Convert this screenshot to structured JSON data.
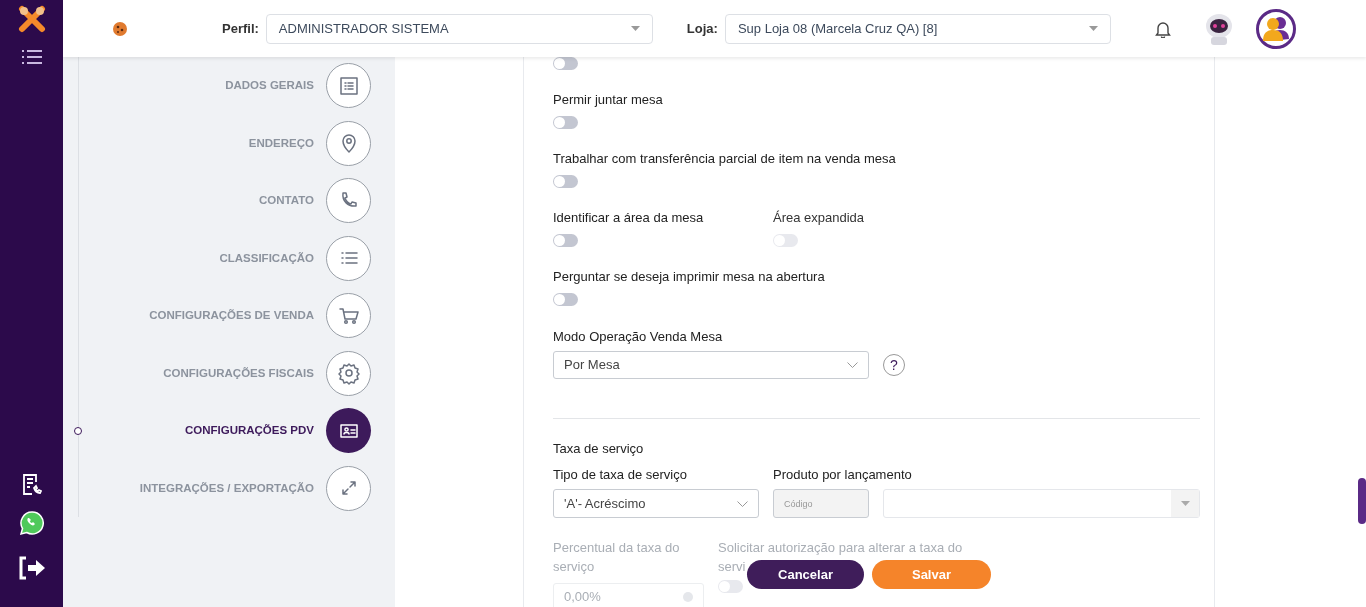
{
  "header": {
    "profile_label": "Perfil:",
    "profile_value": "ADMINISTRADOR SISTEMA",
    "store_label": "Loja:",
    "store_value": "Sup Loja 08 (Marcela Cruz QA) [8]"
  },
  "steps": [
    {
      "label": "DADOS GERAIS",
      "selected": false
    },
    {
      "label": "ENDEREÇO",
      "selected": false
    },
    {
      "label": "CONTATO",
      "selected": false
    },
    {
      "label": "CLASSIFICAÇÃO",
      "selected": false
    },
    {
      "label": "CONFIGURAÇÕES DE VENDA",
      "selected": false
    },
    {
      "label": "CONFIGURAÇÕES FISCAIS",
      "selected": false
    },
    {
      "label": "CONFIGURAÇÕES PDV",
      "selected": true
    },
    {
      "label": "INTEGRAÇÕES / EXPORTAÇÃO",
      "selected": false
    }
  ],
  "rows": [
    {
      "fields": [
        {
          "kind": "toggle",
          "on": false,
          "disabled": false
        }
      ]
    },
    {
      "fields": [
        {
          "kind": "toggle",
          "label": "Permir juntar mesa",
          "on": false,
          "disabled": false
        }
      ]
    },
    {
      "fields": [
        {
          "kind": "toggle",
          "label": "Trabalhar com transferência parcial de item na venda mesa",
          "on": false,
          "disabled": false
        }
      ]
    },
    {
      "fields": [
        {
          "kind": "toggle",
          "label": "Identificar a área da mesa",
          "on": false,
          "disabled": false
        },
        {
          "kind": "toggle",
          "label": "Área expandida",
          "on": false,
          "disabled": true
        }
      ]
    },
    {
      "fields": [
        {
          "kind": "toggle",
          "label": "Perguntar se deseja imprimir mesa na abertura",
          "on": false,
          "disabled": false
        }
      ]
    },
    {
      "fields": [
        {
          "kind": "select",
          "label": "Modo Operação Venda Mesa",
          "value": "Por Mesa",
          "help": "?"
        }
      ]
    }
  ],
  "service": {
    "title": "Taxa de serviço",
    "type_label": "Tipo de taxa de serviço",
    "type_value": "'A'- Acréscimo",
    "product_label": "Produto por lançamento",
    "code_placeholder": "Código",
    "percent_label": "Percentual da taxa do serviço",
    "percent_value": "0,00%",
    "auth_label_lines": [
      "Solicitar autorização para alterar a taxa do",
      "servi"
    ],
    "auth_on": false
  },
  "footer": {
    "cancel": "Cancelar",
    "save": "Salvar"
  }
}
